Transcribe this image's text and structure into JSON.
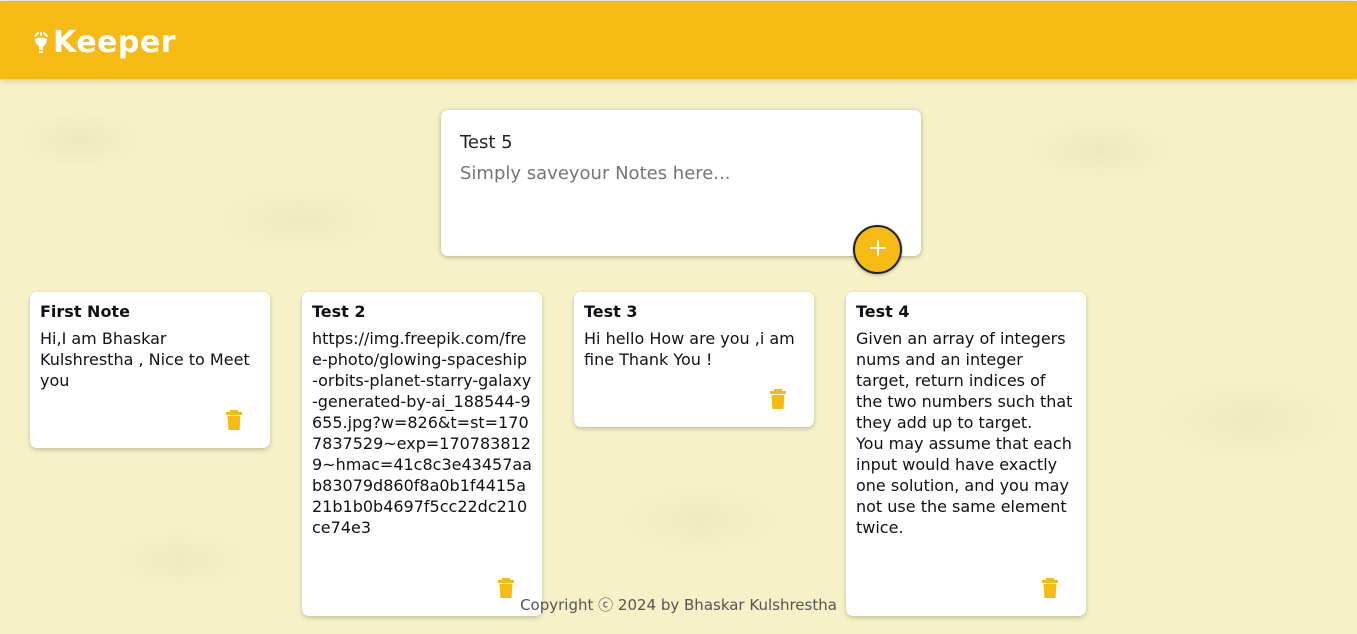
{
  "colors": {
    "header_bg": "#f5ba13",
    "page_bg": "#f6f1c6",
    "accent": "#f5ba13",
    "card_bg": "#ffffff"
  },
  "header": {
    "app_name": "Keeper",
    "logo_icon": "lightbulb-icon"
  },
  "create_note": {
    "title_value": "Test 5",
    "content_placeholder": "Simply saveyour Notes here...",
    "add_icon": "plus-icon"
  },
  "notes": [
    {
      "title": "First Note",
      "content": "Hi,I am Bhaskar Kulshrestha , Nice to Meet you",
      "delete_icon": "trash-icon"
    },
    {
      "title": "Test 2",
      "content": "https://img.freepik.com/free-photo/glowing-spaceship-orbits-planet-starry-galaxy-generated-by-ai_188544-9655.jpg?w=826&t=st=1707837529~exp=1707838129~hmac=41c8c3e43457aab83079d860f8a0b1f4415a21b1b0b4697f5cc22dc210ce74e3",
      "delete_icon": "trash-icon"
    },
    {
      "title": "Test 3",
      "content": "Hi hello How are you ,i am fine Thank You !",
      "delete_icon": "trash-icon"
    },
    {
      "title": "Test 4",
      "content": "Given an array of integers nums and an integer target, return indices of the two numbers such that they add up to target.\nYou may assume that each input would have exactly one solution, and you may not use the same element twice.",
      "delete_icon": "trash-icon"
    }
  ],
  "footer": {
    "text": "Copyright ⓒ 2024 by Bhaskar Kulshrestha"
  }
}
